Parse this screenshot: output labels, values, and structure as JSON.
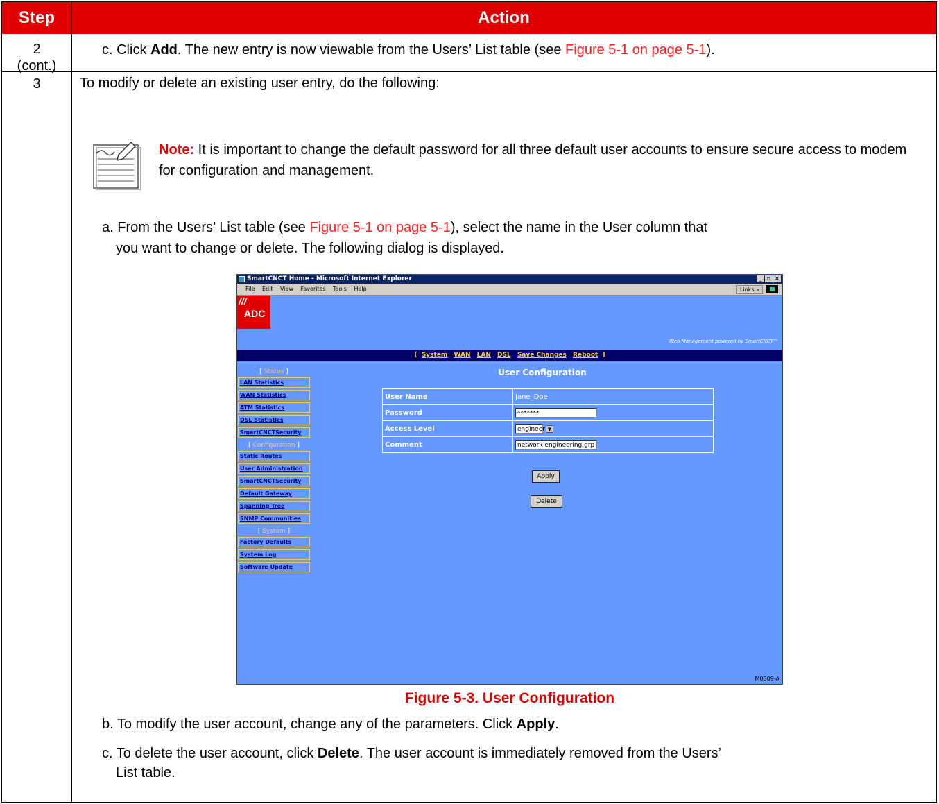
{
  "header": {
    "step": "Step",
    "action": "Action"
  },
  "row2": {
    "step": "2",
    "step_cont": "(cont.)",
    "text_pre": "c. Click ",
    "text_bold": "Add",
    "text_mid": ". The new entry is now viewable from the Users’ List table (see ",
    "text_link": "Figure 5-1 on page 5-1",
    "text_post": ")."
  },
  "row3": {
    "step": "3",
    "intro": "To modify or delete an existing user entry, do the following:",
    "note_label": "Note:",
    "note_text": " It is important to change the default password for all three default user accounts to ensure secure access to modem for configuration and management.",
    "a_pre": "a. From the Users’ List table (see ",
    "a_link": "Figure 5-1 on page 5-1",
    "a_post": "), select the name in the User column that",
    "a_line2": "you want to change or delete. The following dialog is displayed.",
    "b_pre": "b. To modify the user account, change any of the parameters. Click ",
    "b_bold": "Apply",
    "b_post": ".",
    "c_pre": "c. To delete the user account, click ",
    "c_bold": "Delete",
    "c_post": ". The user account is immediately removed from the Users’",
    "c_line2": "List table."
  },
  "screenshot": {
    "window_title": "SmartCNCT Home - Microsoft Internet Explorer",
    "menu": [
      "File",
      "Edit",
      "View",
      "Favorites",
      "Tools",
      "Help"
    ],
    "links_label": "Links »",
    "logo_text": "ADC",
    "powered_by": "Web Management powered by SmartCNCT™",
    "nav": [
      "System",
      "WAN",
      "LAN",
      "DSL",
      "Save Changes",
      "Reboot"
    ],
    "sidebar": {
      "status_header": "Status",
      "status_items": [
        "LAN Statistics",
        "WAN Statistics",
        "ATM Statistics",
        "DSL Statistics",
        "SmartCNCTSecurity"
      ],
      "config_header": "Configuration",
      "config_items": [
        "Static Routes",
        "User Administration",
        "SmartCNCTSecurity",
        "Default Gateway",
        "Spanning Tree",
        "SNMP Communities"
      ],
      "system_header": "System",
      "system_items": [
        "Factory Defaults",
        "System Log",
        "Software Update"
      ]
    },
    "page_title": "User Configuration",
    "form": {
      "user_name_label": "User Name",
      "user_name_value": "Jane_Doe",
      "password_label": "Password",
      "password_value": "*******",
      "access_level_label": "Access Level",
      "access_level_value": "engineer",
      "comment_label": "Comment",
      "comment_value": "network engineering grp"
    },
    "apply_button": "Apply",
    "delete_button": "Delete",
    "figure_code": "M0309-A"
  },
  "figure_caption": "Figure 5-3. User Configuration"
}
